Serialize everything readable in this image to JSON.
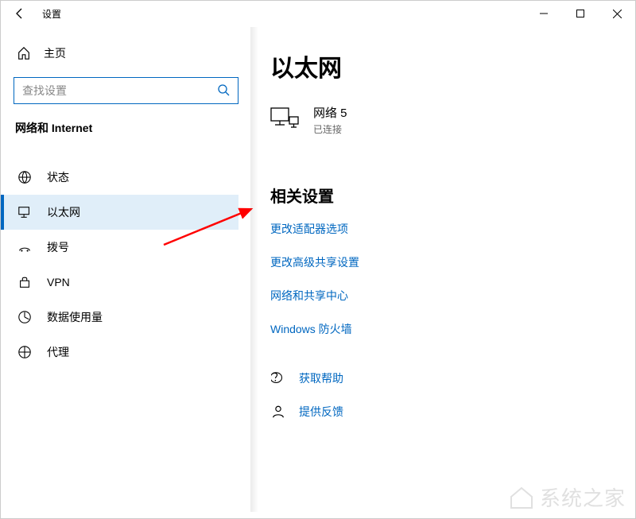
{
  "titlebar": {
    "title": "设置"
  },
  "sidebar": {
    "home_label": "主页",
    "search_placeholder": "查找设置",
    "category_label": "网络和 Internet",
    "items": [
      {
        "label": "状态"
      },
      {
        "label": "以太网"
      },
      {
        "label": "拨号"
      },
      {
        "label": "VPN"
      },
      {
        "label": "数据使用量"
      },
      {
        "label": "代理"
      }
    ]
  },
  "main": {
    "title": "以太网",
    "network": {
      "name": "网络 5",
      "status": "已连接"
    },
    "related_title": "相关设置",
    "links": [
      "更改适配器选项",
      "更改高级共享设置",
      "网络和共享中心",
      "Windows 防火墙"
    ],
    "help": {
      "get_help": "获取帮助",
      "feedback": "提供反馈"
    }
  },
  "watermark": "系统之家"
}
